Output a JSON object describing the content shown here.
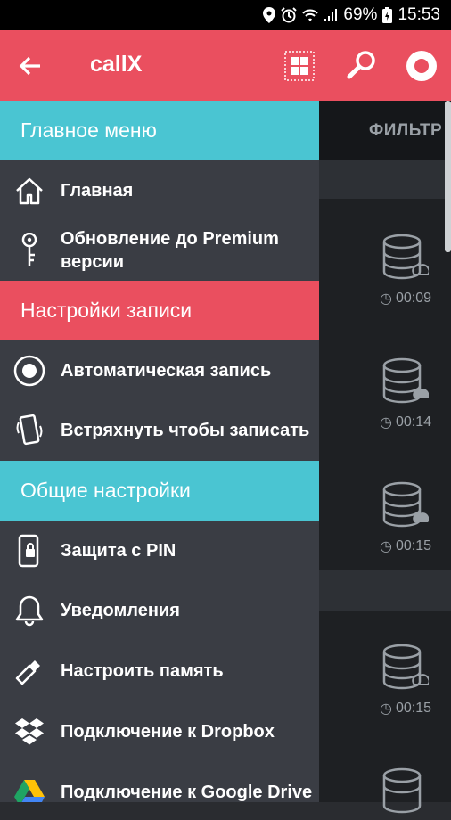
{
  "status_bar": {
    "battery": "69%",
    "time": "15:53"
  },
  "app_bar": {
    "title": "callX"
  },
  "background": {
    "filter_label": "ФИЛЬТР",
    "recordings": [
      {
        "duration": "00:09"
      },
      {
        "duration": "00:14"
      },
      {
        "duration": "00:15"
      },
      {
        "duration": "00:15"
      }
    ]
  },
  "drawer": {
    "sections": [
      {
        "title": "Главное меню",
        "color": "#4ac5d2",
        "items": [
          {
            "label": "Главная",
            "icon": "home-icon"
          },
          {
            "label": "Обновление до Premium версии",
            "icon": "key-icon"
          }
        ]
      },
      {
        "title": "Настройки записи",
        "color": "#ea4f5f",
        "items": [
          {
            "label": "Автоматическая запись",
            "icon": "record-toggle-icon"
          },
          {
            "label": "Встряхнуть чтобы записать",
            "icon": "shake-phone-icon"
          }
        ]
      },
      {
        "title": "Общие настройки",
        "color": "#4ac5d2",
        "items": [
          {
            "label": "Защита с PIN",
            "icon": "pin-lock-icon"
          },
          {
            "label": "Уведомления",
            "icon": "bell-icon"
          },
          {
            "label": "Настроить память",
            "icon": "usb-storage-icon"
          },
          {
            "label": "Подключение к Dropbox",
            "icon": "dropbox-icon"
          },
          {
            "label": "Подключение к Google Drive",
            "icon": "google-drive-icon"
          }
        ]
      }
    ]
  },
  "colors": {
    "accent_red": "#ea4f5f",
    "accent_teal": "#4ac5d2",
    "drawer_bg": "#3a3d44"
  }
}
